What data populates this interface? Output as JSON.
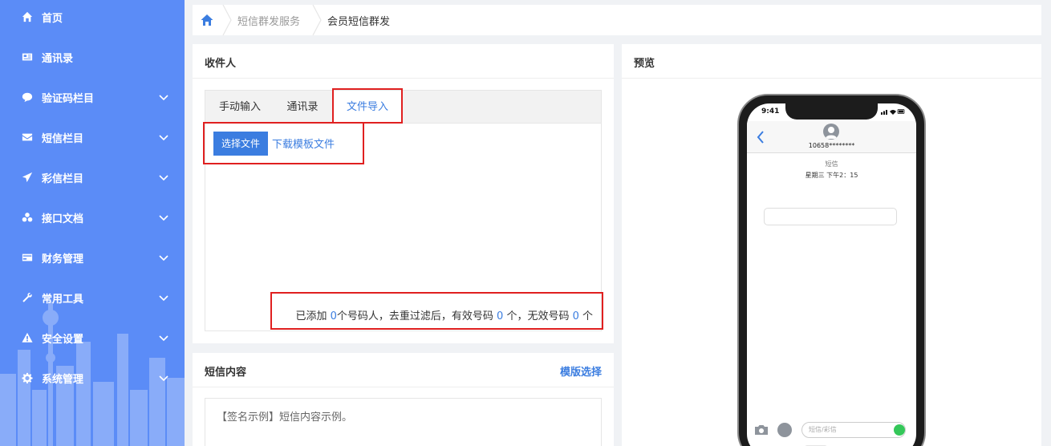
{
  "sidebar": {
    "items": [
      {
        "label": "首页",
        "icon": "home-icon",
        "has_children": false
      },
      {
        "label": "通讯录",
        "icon": "contact-card-icon",
        "has_children": false
      },
      {
        "label": "验证码栏目",
        "icon": "chat-bubble-icon",
        "has_children": true
      },
      {
        "label": "短信栏目",
        "icon": "envelope-icon",
        "has_children": true
      },
      {
        "label": "彩信栏目",
        "icon": "paper-plane-icon",
        "has_children": true
      },
      {
        "label": "接口文档",
        "icon": "cubes-icon",
        "has_children": true
      },
      {
        "label": "财务管理",
        "icon": "credit-card-icon",
        "has_children": true
      },
      {
        "label": "常用工具",
        "icon": "wrench-icon",
        "has_children": true
      },
      {
        "label": "安全设置",
        "icon": "warning-icon",
        "has_children": true
      },
      {
        "label": "系统管理",
        "icon": "gear-icon",
        "has_children": true
      }
    ]
  },
  "breadcrumb": {
    "level1": "短信群发服务",
    "level2": "会员短信群发"
  },
  "recipients": {
    "title": "收件人",
    "tabs": [
      "手动输入",
      "通讯录",
      "文件导入"
    ],
    "active_tab": "文件导入",
    "choose_file_label": "选择文件",
    "download_template_label": "下载模板文件",
    "summary": {
      "part1": "已添加 ",
      "added": "0",
      "part2": "个号码人，去重过滤后，有效号码 ",
      "valid": "0",
      "part3": " 个，无效号码 ",
      "invalid": "0",
      "part4": " 个"
    }
  },
  "sms_content": {
    "title": "短信内容",
    "template_select_label": "模版选择",
    "placeholder": "【签名示例】短信内容示例。"
  },
  "preview": {
    "title": "预览",
    "phone": {
      "time": "9:41",
      "sender": "10658********",
      "message_type": "短信",
      "message_time": "星期三 下午2：15",
      "input_placeholder": "短信/彩信"
    }
  },
  "colors": {
    "sidebar_bg": "#5b8cf7",
    "accent": "#3b7de0",
    "highlight_border": "#e02020"
  }
}
